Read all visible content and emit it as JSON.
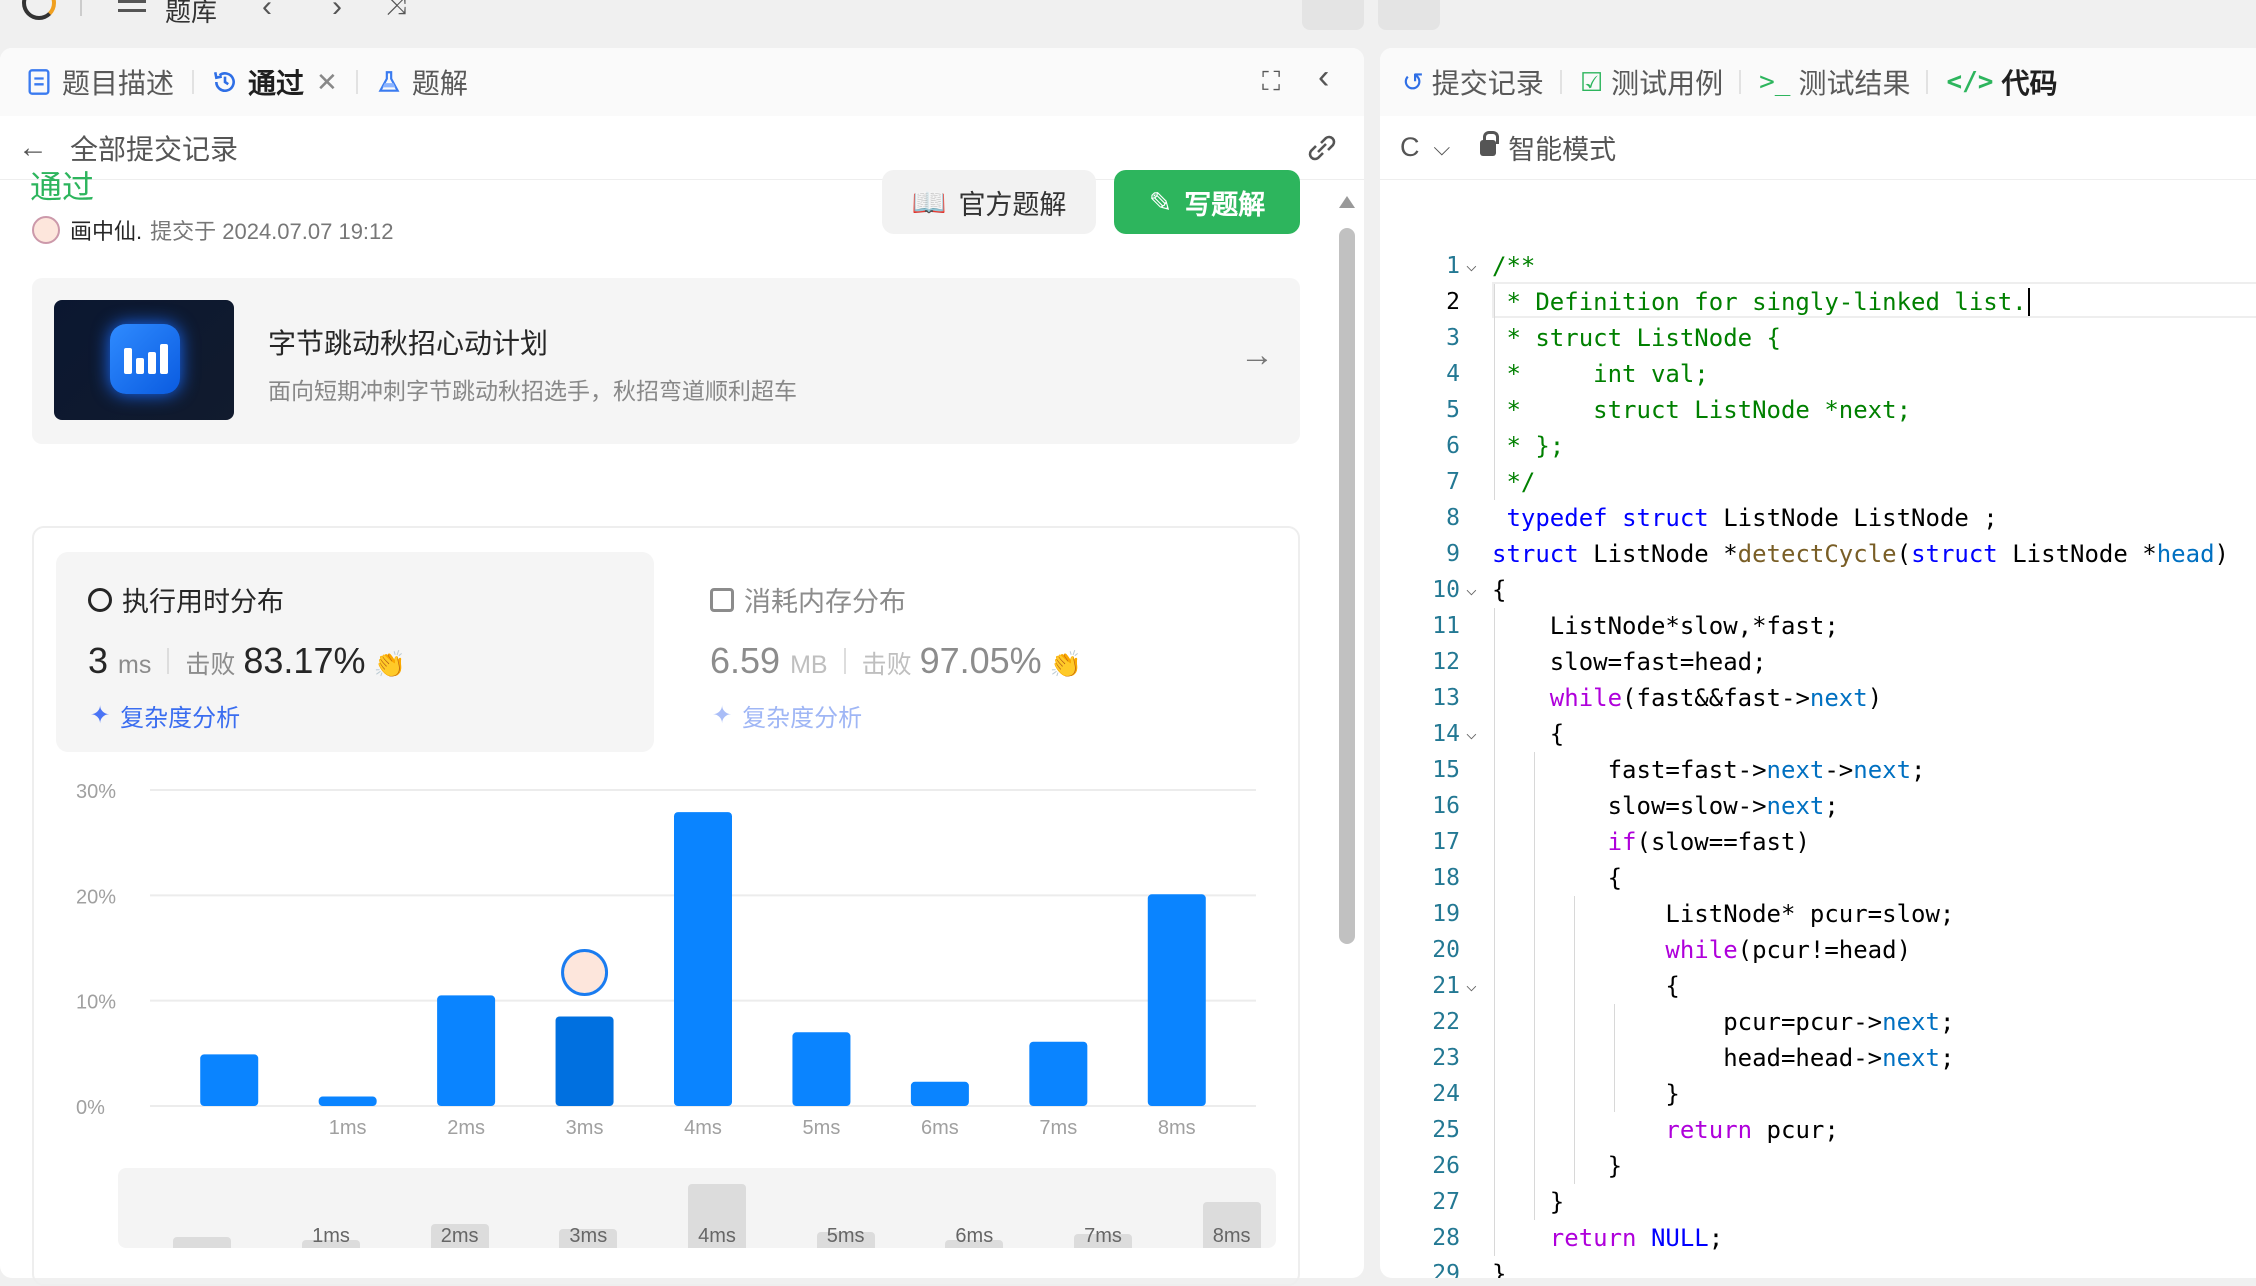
{
  "topbar": {
    "title": "题库"
  },
  "left": {
    "tabs": [
      {
        "label": "题目描述"
      },
      {
        "label": "通过"
      },
      {
        "label": "题解"
      }
    ],
    "subhead": "全部提交记录",
    "status": "通过",
    "submitter": {
      "name": "画中仙.",
      "text": "提交于 2024.07.07 19:12"
    },
    "buttons": {
      "official": "官方题解",
      "write": "写题解"
    },
    "banner": {
      "title": "字节跳动秋招心动计划",
      "subtitle": "面向短期冲刺字节跳动秋招选手，秋招弯道顺利超车"
    },
    "runtime": {
      "title": "执行用时分布",
      "value": "3",
      "unit": "ms",
      "beat_label": "击败",
      "beat": "83.17%",
      "complexity": "复杂度分析"
    },
    "memory": {
      "title": "消耗内存分布",
      "value": "6.59",
      "unit": "MB",
      "beat_label": "击败",
      "beat": "97.05%",
      "complexity": "复杂度分析"
    }
  },
  "chart_data": {
    "type": "bar",
    "categories": [
      "",
      "1ms",
      "2ms",
      "3ms",
      "4ms",
      "5ms",
      "6ms",
      "7ms",
      "8ms"
    ],
    "values": [
      4.9,
      0.9,
      10.5,
      8.5,
      27.9,
      7.0,
      2.3,
      6.1,
      20.1
    ],
    "highlight_index": 3,
    "yticks": [
      "0%",
      "10%",
      "20%",
      "30%"
    ],
    "ylim": [
      0,
      30
    ],
    "grid": true,
    "bar_color": "#0a84ff",
    "highlight_color": "#0070e0"
  },
  "range_data": {
    "labels": [
      "1ms",
      "2ms",
      "3ms",
      "4ms",
      "5ms",
      "6ms",
      "7ms",
      "8ms"
    ],
    "values": [
      4.9,
      0.9,
      10.5,
      8.5,
      27.9,
      7.0,
      2.3,
      6.1,
      20.1
    ]
  },
  "right": {
    "tabs": [
      {
        "label": "提交记录"
      },
      {
        "label": "测试用例"
      },
      {
        "label": "测试结果"
      },
      {
        "label": "代码"
      }
    ],
    "language": "C",
    "mode": "智能模式",
    "code": [
      "/**",
      " * Definition for singly-linked list.",
      " * struct ListNode {",
      " *     int val;",
      " *     struct ListNode *next;",
      " * };",
      " */",
      " typedef struct ListNode ListNode ;",
      "struct ListNode *detectCycle(struct ListNode *head)",
      "{",
      "    ListNode*slow,*fast;",
      "    slow=fast=head;",
      "    while(fast&&fast->next)",
      "    {",
      "        fast=fast->next->next;",
      "        slow=slow->next;",
      "        if(slow==fast)",
      "        {",
      "            ListNode* pcur=slow;",
      "            while(pcur!=head)",
      "            {",
      "                pcur=pcur->next;",
      "                head=head->next;",
      "            }",
      "            return pcur;",
      "        }",
      "    }",
      "    return NULL;",
      "}"
    ]
  }
}
